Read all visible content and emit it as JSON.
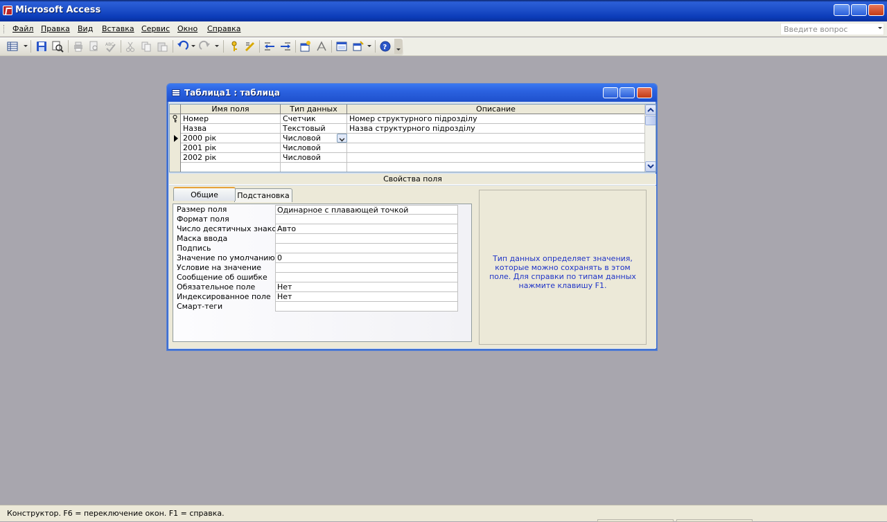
{
  "app": {
    "title": "Microsoft Access"
  },
  "menu": {
    "items": [
      {
        "label": "Файл"
      },
      {
        "label": "Правка"
      },
      {
        "label": "Вид"
      },
      {
        "label": "Вставка"
      },
      {
        "label": "Сервис"
      },
      {
        "label": "Окно"
      },
      {
        "label": "Справка"
      }
    ],
    "help_placeholder": "Введите вопрос"
  },
  "toolbar": {
    "icons": [
      "view-icon",
      "save-icon",
      "search-icon",
      "print-icon",
      "print-preview-icon",
      "spelling-icon",
      "cut-icon",
      "copy-icon",
      "paste-icon",
      "undo-icon",
      "redo-icon",
      "primary-key-icon",
      "build-icon",
      "insert-rows-icon",
      "delete-rows-icon",
      "properties-icon",
      "indexes-icon",
      "database-window-icon",
      "new-object-icon",
      "help-icon"
    ]
  },
  "window": {
    "title": "Таблица1 : таблица"
  },
  "grid": {
    "headers": [
      "Имя поля",
      "Тип данных",
      "Описание"
    ],
    "rows": [
      {
        "name": "Номер",
        "type": "Счетчик",
        "desc": "Номер структурного підрозділу",
        "key": true
      },
      {
        "name": "Назва",
        "type": "Текстовый",
        "desc": "Назва структурного підрозділу"
      },
      {
        "name": "2000 рік",
        "type": "Числовой",
        "desc": "",
        "current": true
      },
      {
        "name": "2001 рік",
        "type": "Числовой",
        "desc": ""
      },
      {
        "name": "2002 рік",
        "type": "Числовой",
        "desc": ""
      },
      {
        "name": "",
        "type": "",
        "desc": ""
      }
    ]
  },
  "properties": {
    "title": "Свойства поля",
    "tabs": [
      {
        "label": "Общие",
        "active": true
      },
      {
        "label": "Подстановка",
        "active": false
      }
    ],
    "rows": [
      {
        "label": "Размер поля",
        "value": "Одинарное с плавающей точкой"
      },
      {
        "label": "Формат поля",
        "value": ""
      },
      {
        "label": "Число десятичных знаков",
        "value": "Авто"
      },
      {
        "label": "Маска ввода",
        "value": ""
      },
      {
        "label": "Подпись",
        "value": ""
      },
      {
        "label": "Значение по умолчанию",
        "value": "0"
      },
      {
        "label": "Условие на значение",
        "value": ""
      },
      {
        "label": "Сообщение об ошибке",
        "value": ""
      },
      {
        "label": "Обязательное поле",
        "value": "Нет"
      },
      {
        "label": "Индексированное поле",
        "value": "Нет"
      },
      {
        "label": "Смарт-теги",
        "value": ""
      }
    ],
    "help_text": "Тип данных определяет значения, которые можно сохранять в этом поле.  Для справки по типам данных нажмите клавишу F1."
  },
  "status": {
    "text": "Конструктор.  F6 = переключение окон.  F1 = справка."
  }
}
